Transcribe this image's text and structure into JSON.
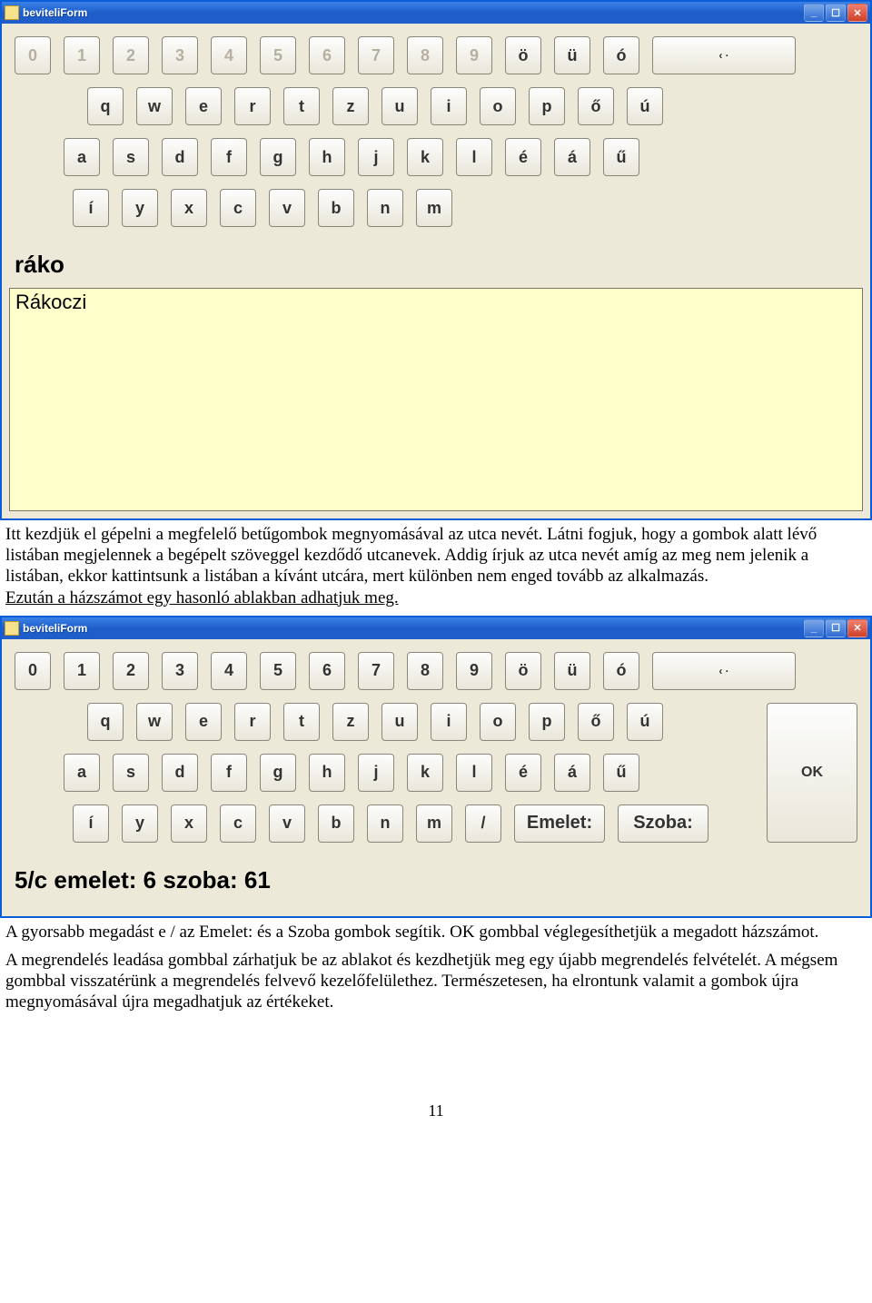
{
  "win1": {
    "title": "beviteliForm",
    "row1": [
      "0",
      "1",
      "2",
      "3",
      "4",
      "5",
      "6",
      "7",
      "8",
      "9",
      "ö",
      "ü",
      "ó"
    ],
    "back_label": "‹ ·",
    "row2": [
      "q",
      "w",
      "e",
      "r",
      "t",
      "z",
      "u",
      "i",
      "o",
      "p",
      "ő",
      "ú"
    ],
    "row3": [
      "a",
      "s",
      "d",
      "f",
      "g",
      "h",
      "j",
      "k",
      "l",
      "é",
      "á",
      "ű"
    ],
    "row4": [
      "í",
      "y",
      "x",
      "c",
      "v",
      "b",
      "n",
      "m"
    ],
    "typed": "ráko",
    "list": {
      "item0": "Rákoczi"
    }
  },
  "para1": "Itt kezdjük el gépelni a megfelelő betűgombok megnyomásával az utca nevét. Látni fogjuk, hogy a gombok alatt lévő listában megjelennek a begépelt szöveggel kezdődő utcanevek. Addig írjuk az utca nevét amíg az meg nem jelenik a listában, ekkor kattintsunk a listában a kívánt utcára, mert különben nem enged tovább az alkalmazás.",
  "para1u": "Ezután a házszámot egy hasonló ablakban adhatjuk meg.",
  "win2": {
    "title": "beviteliForm",
    "row1": [
      "0",
      "1",
      "2",
      "3",
      "4",
      "5",
      "6",
      "7",
      "8",
      "9",
      "ö",
      "ü",
      "ó"
    ],
    "back_label": "‹ ·",
    "row2": [
      "q",
      "w",
      "e",
      "r",
      "t",
      "z",
      "u",
      "i",
      "o",
      "p",
      "ő",
      "ú"
    ],
    "row3": [
      "a",
      "s",
      "d",
      "f",
      "g",
      "h",
      "j",
      "k",
      "l",
      "é",
      "á",
      "ű"
    ],
    "row4": [
      "í",
      "y",
      "x",
      "c",
      "v",
      "b",
      "n",
      "m",
      "/"
    ],
    "emelet_label": "Emelet:",
    "szoba_label": "Szoba:",
    "ok_label": "OK",
    "output": "5/c emelet: 6 szoba: 61"
  },
  "para2": "A gyorsabb megadást e / az Emelet: és a Szoba gombok segítik. OK gombbal véglegesíthetjük a megadott házszámot.",
  "para3": "A megrendelés leadása gombbal zárhatjuk be az ablakot és kezdhetjük meg egy újabb megrendelés felvételét. A mégsem gombbal visszatérünk a megrendelés felvevő kezelőfelülethez. Természetesen, ha elrontunk valamit a gombok újra megnyomásával újra megadhatjuk az értékeket.",
  "page_num": "11"
}
